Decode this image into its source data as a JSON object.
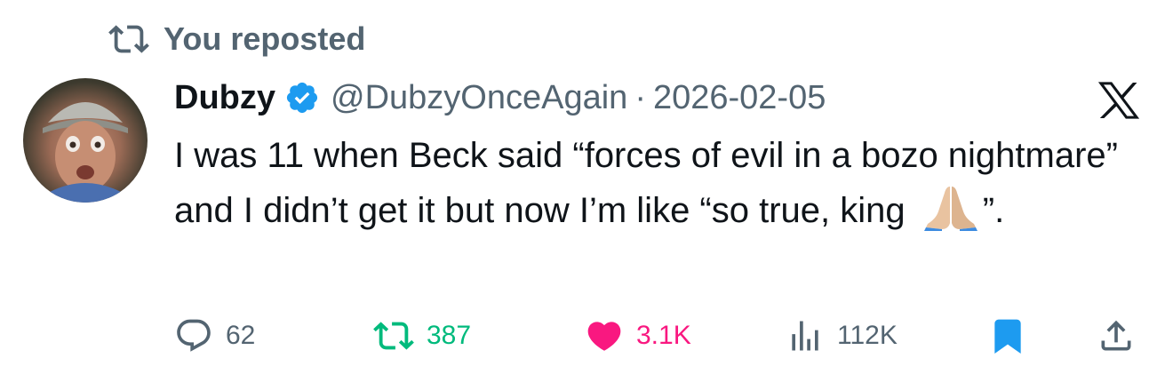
{
  "repost": {
    "label": "You reposted",
    "icon": "retweet-icon"
  },
  "author": {
    "display_name": "Dubzy",
    "handle": "@DubzyOnceAgain",
    "separator": "·",
    "date": "2026-02-05",
    "verified": true,
    "verified_icon": "verified-badge-icon"
  },
  "platform": {
    "logo": "x-logo-icon"
  },
  "tweet": {
    "text_before_emoji": "I was 11 when Beck said “forces of evil in a bozo nightmare” and I didn’t get it but now I’m like “so true, king ",
    "emoji": "🙏",
    "emoji_icon": "folded-hands-icon",
    "text_after_emoji": "”."
  },
  "metrics": {
    "replies": "62",
    "reposts": "387",
    "likes": "3.1K",
    "views": "112K"
  },
  "colors": {
    "text_primary": "#0f1419",
    "text_secondary": "#536471",
    "verified_blue": "#1d9bf0",
    "repost_green": "#00ba7c",
    "like_pink": "#f91880",
    "bookmark_blue": "#1d9bf0"
  }
}
